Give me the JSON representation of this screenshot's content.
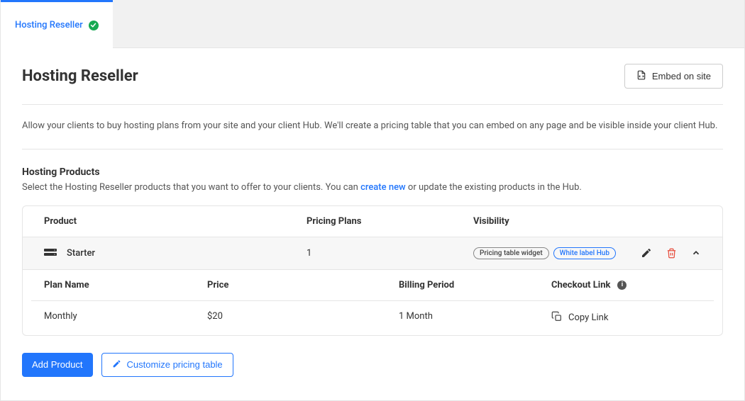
{
  "tab": {
    "label": "Hosting Reseller"
  },
  "header": {
    "title": "Hosting Reseller",
    "embed_label": "Embed on site"
  },
  "intro": "Allow your clients to buy hosting plans from your site and your client Hub. We'll create a pricing table that you can embed on any page and be visible inside your client Hub.",
  "products": {
    "title": "Hosting Products",
    "desc_before": "Select the Hosting Reseller products that you want to offer to your clients. You can ",
    "desc_link": "create new",
    "desc_after": " or update the existing products in the Hub.",
    "columns": {
      "product": "Product",
      "pricing": "Pricing Plans",
      "visibility": "Visibility"
    },
    "items": [
      {
        "name": "Starter",
        "plan_count": "1",
        "badges": [
          "Pricing table widget",
          "White label Hub"
        ]
      }
    ],
    "sub_columns": {
      "name": "Plan Name",
      "price": "Price",
      "period": "Billing Period",
      "link": "Checkout Link"
    },
    "plans": [
      {
        "name": "Monthly",
        "price": "$20",
        "period": "1 Month",
        "link_label": "Copy Link"
      }
    ]
  },
  "actions": {
    "add": "Add Product",
    "customize": "Customize pricing table"
  }
}
